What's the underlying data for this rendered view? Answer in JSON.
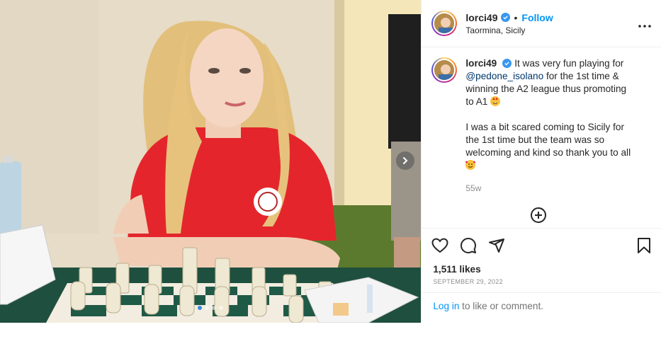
{
  "header": {
    "username": "lorci49",
    "separator": "•",
    "follow_label": "Follow",
    "location": "Taormina, Sicily",
    "more_icon": "more-horizontal-icon"
  },
  "caption": {
    "username": "lorci49",
    "text_part1": "It was very fun playing for ",
    "mention": "@pedone_isolano",
    "text_part2": " for the 1st time & winning the A2 league thus promoting to A1 ",
    "paragraph2": "I was a bit scared coming to Sicily for the 1st time but the team was so welcoming and kind so thank you to all ",
    "time_ago": "55w"
  },
  "actions": {
    "like_icon": "heart-icon",
    "comment_icon": "comment-icon",
    "share_icon": "share-icon",
    "save_icon": "bookmark-icon",
    "add_comment_icon": "plus-circle-icon"
  },
  "stats": {
    "likes": "1,511 likes",
    "date": "SEPTEMBER 29, 2022"
  },
  "login": {
    "link_label": "Log in",
    "rest": " to like or comment."
  },
  "carousel": {
    "next_icon": "chevron-right-icon",
    "slide_count": 4,
    "active_index": 0
  },
  "colors": {
    "accent": "#0095f6",
    "verified": "#3897f0",
    "shirt": "#e4262c",
    "board_dark": "#1f5a47"
  }
}
